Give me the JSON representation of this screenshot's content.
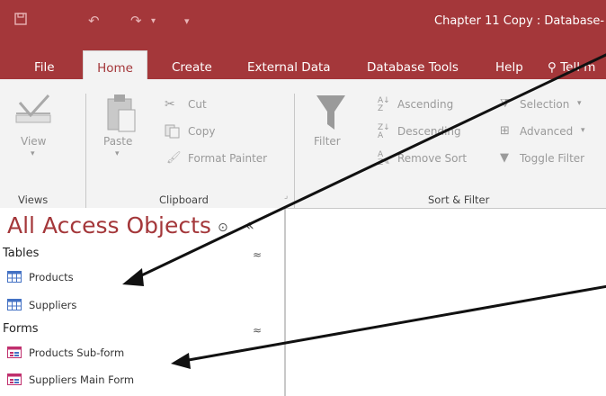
{
  "window": {
    "title": "Chapter 11 Copy : Database-"
  },
  "tabs": [
    "File",
    "Home",
    "Create",
    "External Data",
    "Database Tools",
    "Help",
    "Tell m"
  ],
  "ribbon": {
    "view": "View",
    "paste": "Paste",
    "cut": "Cut",
    "copy": "Copy",
    "format_painter": "Format Painter",
    "filter": "Filter",
    "ascending": "Ascending",
    "descending": "Descending",
    "remove_sort": "Remove Sort",
    "selection": "Selection",
    "advanced": "Advanced",
    "toggle_filter": "Toggle Filter",
    "groups": [
      "Views",
      "Clipboard",
      "Sort & Filter"
    ]
  },
  "nav": {
    "title": "All Access Objects",
    "sections": [
      {
        "name": "Tables",
        "items": [
          "Products",
          "Suppliers"
        ]
      },
      {
        "name": "Forms",
        "items": [
          "Products Sub-form",
          "Suppliers Main Form"
        ]
      }
    ]
  },
  "colors": {
    "accent": "#a4373a",
    "ribbon": "#f3f3f3"
  }
}
